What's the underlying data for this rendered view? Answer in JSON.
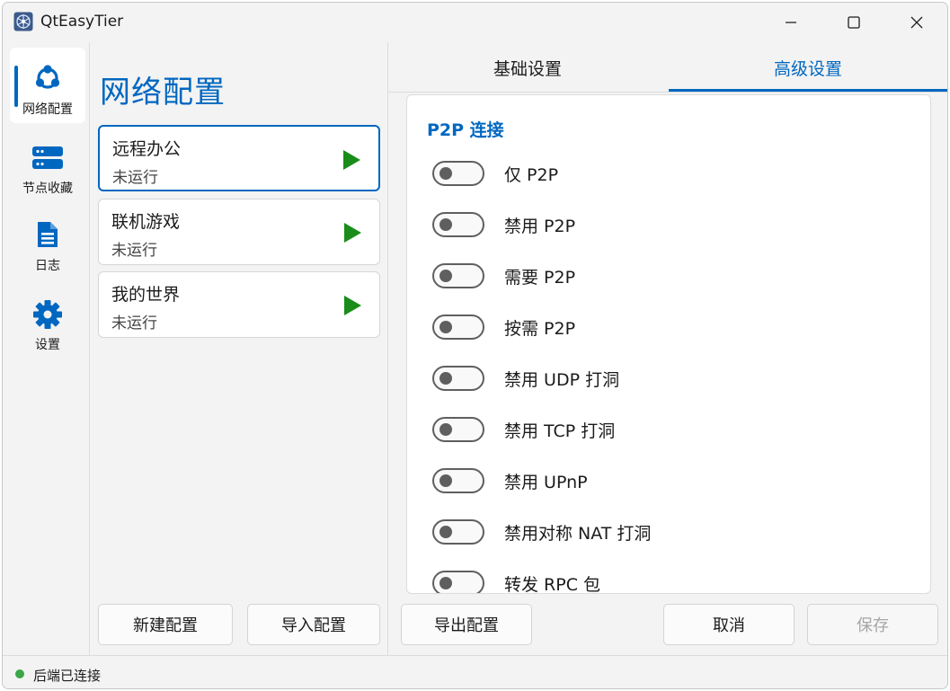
{
  "window": {
    "title": "QtEasyTier"
  },
  "nav": {
    "items": [
      {
        "label": "网络配置",
        "icon": "network-icon",
        "active": true
      },
      {
        "label": "节点收藏",
        "icon": "server-icon",
        "active": false
      },
      {
        "label": "日志",
        "icon": "document-icon",
        "active": false
      },
      {
        "label": "设置",
        "icon": "gear-icon",
        "active": false
      }
    ]
  },
  "configs": {
    "title": "网络配置",
    "items": [
      {
        "name": "远程办公",
        "status": "未运行"
      },
      {
        "name": "联机游戏",
        "status": "未运行"
      },
      {
        "name": "我的世界",
        "status": "未运行"
      }
    ],
    "new_label": "新建配置",
    "import_label": "导入配置"
  },
  "tabs": [
    {
      "label": "基础设置",
      "active": false
    },
    {
      "label": "高级设置",
      "active": true
    }
  ],
  "advanced": {
    "section_title": "P2P 连接",
    "options": [
      {
        "label": "仅 P2P",
        "enabled": false
      },
      {
        "label": "禁用 P2P",
        "enabled": false
      },
      {
        "label": "需要 P2P",
        "enabled": false
      },
      {
        "label": "按需 P2P",
        "enabled": false
      },
      {
        "label": "禁用 UDP 打洞",
        "enabled": false
      },
      {
        "label": "禁用 TCP 打洞",
        "enabled": false
      },
      {
        "label": "禁用 UPnP",
        "enabled": false
      },
      {
        "label": "禁用对称 NAT 打洞",
        "enabled": false
      },
      {
        "label": "转发 RPC 包",
        "enabled": false
      }
    ]
  },
  "footer": {
    "export_label": "导出配置",
    "cancel_label": "取消",
    "save_label": "保存"
  },
  "status": {
    "text": "后端已连接",
    "color": "#3aa648"
  },
  "colors": {
    "accent": "#0067c0",
    "play": "#1a8c1a"
  }
}
